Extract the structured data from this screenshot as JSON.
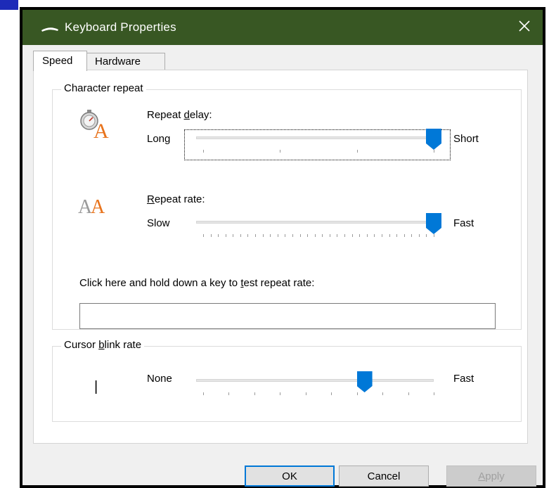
{
  "window": {
    "title": "Keyboard Properties",
    "close_glyph": "✕"
  },
  "tabs": [
    {
      "label": "Speed",
      "selected": true
    },
    {
      "label": "Hardware",
      "selected": false
    }
  ],
  "character_repeat": {
    "legend": "Character repeat",
    "repeat_delay": {
      "label_pre": "Repeat ",
      "label_ul": "d",
      "label_post": "elay:",
      "min_label": "Long",
      "max_label": "Short",
      "value_fraction": 1.0
    },
    "repeat_rate": {
      "label_ul": "R",
      "label_post": "epeat rate:",
      "min_label": "Slow",
      "max_label": "Fast",
      "value_fraction": 1.0
    },
    "test": {
      "label_pre": "Click here and hold down a key to ",
      "label_ul": "t",
      "label_post": "est repeat rate:",
      "value": ""
    }
  },
  "cursor_blink": {
    "legend_pre": "Cursor ",
    "legend_ul": "b",
    "legend_post": "link rate",
    "min_label": "None",
    "max_label": "Fast",
    "cursor_glyph": "|",
    "value_fraction": 0.7
  },
  "buttons": {
    "ok": "OK",
    "cancel": "Cancel",
    "apply_ul": "A",
    "apply_rest": "pply"
  },
  "colors": {
    "titlebar": "#385723",
    "accent": "#0078d7",
    "icon_orange": "#e8731c"
  },
  "icons": {
    "app": "keyboard-icon",
    "close": "close-icon",
    "delay": "stopwatch-letter-a-icon",
    "rate": "double-letter-a-icon"
  }
}
